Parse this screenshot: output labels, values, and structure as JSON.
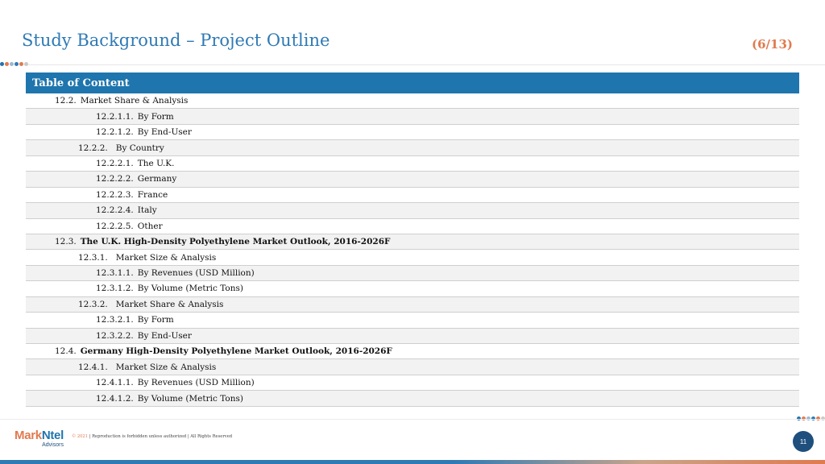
{
  "header": {
    "title": "Study Background – Project Outline",
    "page_count": "(6/13)"
  },
  "colors": {
    "accent_blue": "#2f7ab5",
    "header_blue": "#1f75ad",
    "accent_orange": "#e07a4f",
    "navy": "#1e4f7d",
    "row_alt": "#f2f2f2"
  },
  "dots": [
    "#1f75ad",
    "#e07a4f",
    "#9cb8cf",
    "#2f7ab5",
    "#e07a4f",
    "#c8c8c8"
  ],
  "toc": {
    "header": "Table of Content",
    "rows": [
      {
        "level": 1,
        "num": "12.2.",
        "label": "Market Share & Analysis",
        "bold": false
      },
      {
        "level": 3,
        "num": "12.2.1.1.",
        "label": "By Form",
        "bold": false
      },
      {
        "level": 3,
        "num": "12.2.1.2.",
        "label": "By End-User",
        "bold": false
      },
      {
        "level": 2,
        "num": "12.2.2.",
        "label": "By Country",
        "bold": false
      },
      {
        "level": 3,
        "num": "12.2.2.1.",
        "label": "The U.K.",
        "bold": false
      },
      {
        "level": 3,
        "num": "12.2.2.2.",
        "label": "Germany",
        "bold": false
      },
      {
        "level": 3,
        "num": "12.2.2.3.",
        "label": "France",
        "bold": false
      },
      {
        "level": 3,
        "num": "12.2.2.4.",
        "label": "Italy",
        "bold": false
      },
      {
        "level": 3,
        "num": "12.2.2.5.",
        "label": "Other",
        "bold": false
      },
      {
        "level": 1,
        "num": "12.3.",
        "label": "The U.K. High-Density Polyethylene Market Outlook, 2016-2026F",
        "bold": true
      },
      {
        "level": 2,
        "num": "12.3.1.",
        "label": "Market Size & Analysis",
        "bold": false
      },
      {
        "level": 3,
        "num": "12.3.1.1.",
        "label": "By Revenues (USD Million)",
        "bold": false
      },
      {
        "level": 3,
        "num": "12.3.1.2.",
        "label": "By Volume (Metric Tons)",
        "bold": false
      },
      {
        "level": 2,
        "num": "12.3.2.",
        "label": "Market Share & Analysis",
        "bold": false
      },
      {
        "level": 3,
        "num": "12.3.2.1.",
        "label": "By Form",
        "bold": false
      },
      {
        "level": 3,
        "num": "12.3.2.2.",
        "label": "By End-User",
        "bold": false
      },
      {
        "level": 1,
        "num": "12.4.",
        "label": "Germany High-Density Polyethylene Market Outlook, 2016-2026F",
        "bold": true
      },
      {
        "level": 2,
        "num": "12.4.1.",
        "label": "Market Size & Analysis",
        "bold": false
      },
      {
        "level": 3,
        "num": "12.4.1.1.",
        "label": "By Revenues (USD Million)",
        "bold": false
      },
      {
        "level": 3,
        "num": "12.4.1.2.",
        "label": "By Volume (Metric Tons)",
        "bold": false
      }
    ]
  },
  "footer": {
    "logo_mark": "Mark",
    "logo_ntel": "Ntel",
    "logo_sub": "Advisors",
    "copyright_year": "© 2021",
    "copyright_text": "| Reproduction is forbidden unless authorized | All Rights Reserved",
    "page_number": "11"
  }
}
